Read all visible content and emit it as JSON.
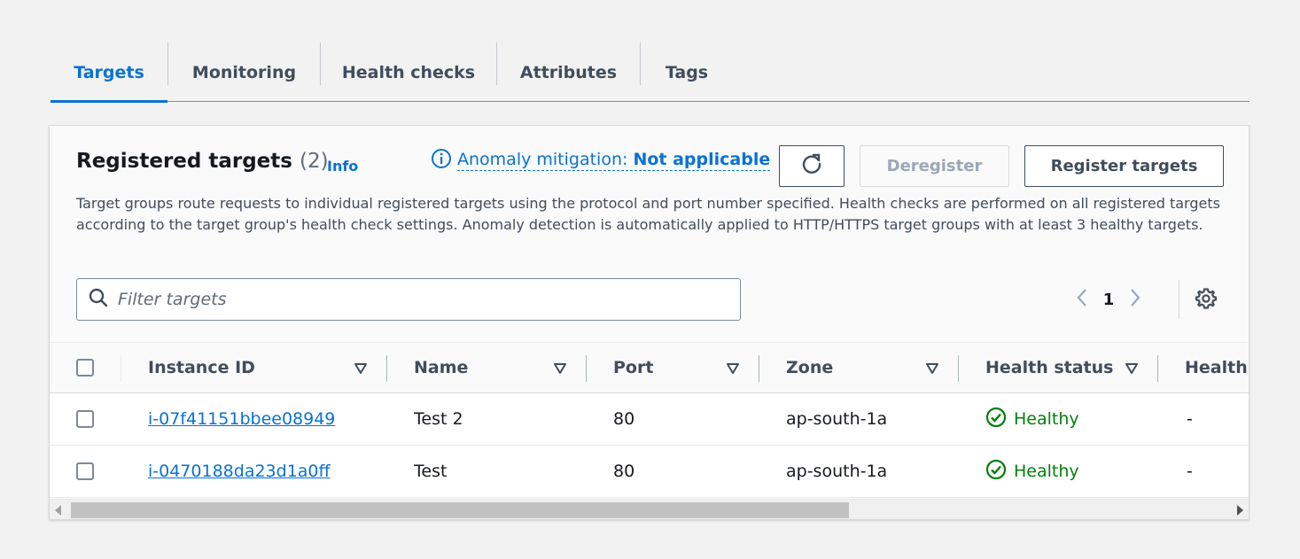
{
  "tabs": [
    {
      "label": "Targets",
      "active": true
    },
    {
      "label": "Monitoring",
      "active": false
    },
    {
      "label": "Health checks",
      "active": false
    },
    {
      "label": "Attributes",
      "active": false
    },
    {
      "label": "Tags",
      "active": false
    }
  ],
  "panel": {
    "title": "Registered targets",
    "count": "(2)",
    "info_label": "Info",
    "anomaly_label": "Anomaly mitigation:",
    "anomaly_value": "Not applicable",
    "deregister_label": "Deregister",
    "register_label": "Register targets",
    "description": "Target groups route requests to individual registered targets using the protocol and port number specified. Health checks are performed on all registered targets according to the target group's health check settings. Anomaly detection is automatically applied to HTTP/HTTPS target groups with at least 3 healthy targets."
  },
  "filter": {
    "placeholder": "Filter targets",
    "value": ""
  },
  "pagination": {
    "current_page": "1"
  },
  "table": {
    "columns": [
      "Instance ID",
      "Name",
      "Port",
      "Zone",
      "Health status",
      "Health s"
    ],
    "rows": [
      {
        "instance_id": "i-07f41151bbee08949",
        "name": "Test 2",
        "port": "80",
        "zone": "ap-south-1a",
        "health_status": "Healthy",
        "health_details": "-"
      },
      {
        "instance_id": "i-0470188da23d1a0ff",
        "name": "Test",
        "port": "80",
        "zone": "ap-south-1a",
        "health_status": "Healthy",
        "health_details": "-"
      }
    ]
  },
  "colors": {
    "accent": "#0972d3",
    "healthy": "#037f0c",
    "text": "#16191f",
    "muted": "#414d5c"
  },
  "icons": [
    "info-icon",
    "refresh-icon",
    "search-icon",
    "chevron-left-icon",
    "chevron-right-icon",
    "gear-icon",
    "sort-down-icon",
    "status-positive-icon"
  ]
}
